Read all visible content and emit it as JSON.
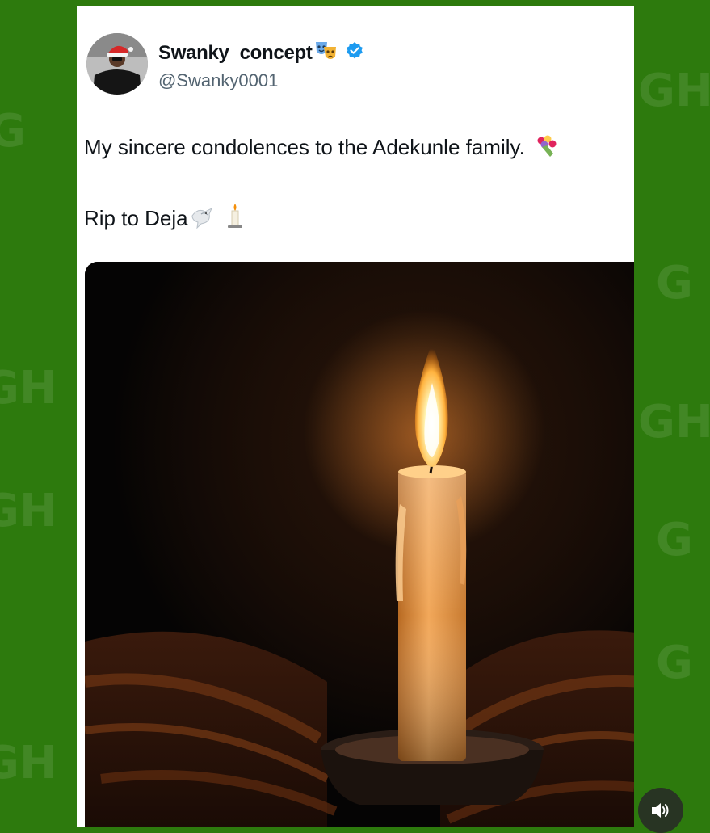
{
  "tweet": {
    "display_name": "Swanky_concept",
    "handle": "@Swanky0001",
    "verified_color": "#1d9bf0",
    "text_line1": "My sincere condolences to the Adekunle family.",
    "text_line2": "Rip to Deja",
    "emojis": [
      "performing-arts-icon",
      "bouquet-icon",
      "dove-icon",
      "candle-icon"
    ]
  },
  "media": {
    "subject": "candle-image"
  },
  "overlay": {
    "sound_button_icon": "speaker-icon"
  },
  "colors": {
    "background": "#2d7a0d",
    "card": "#ffffff",
    "text": "#0f1419",
    "secondary_text": "#536471"
  }
}
